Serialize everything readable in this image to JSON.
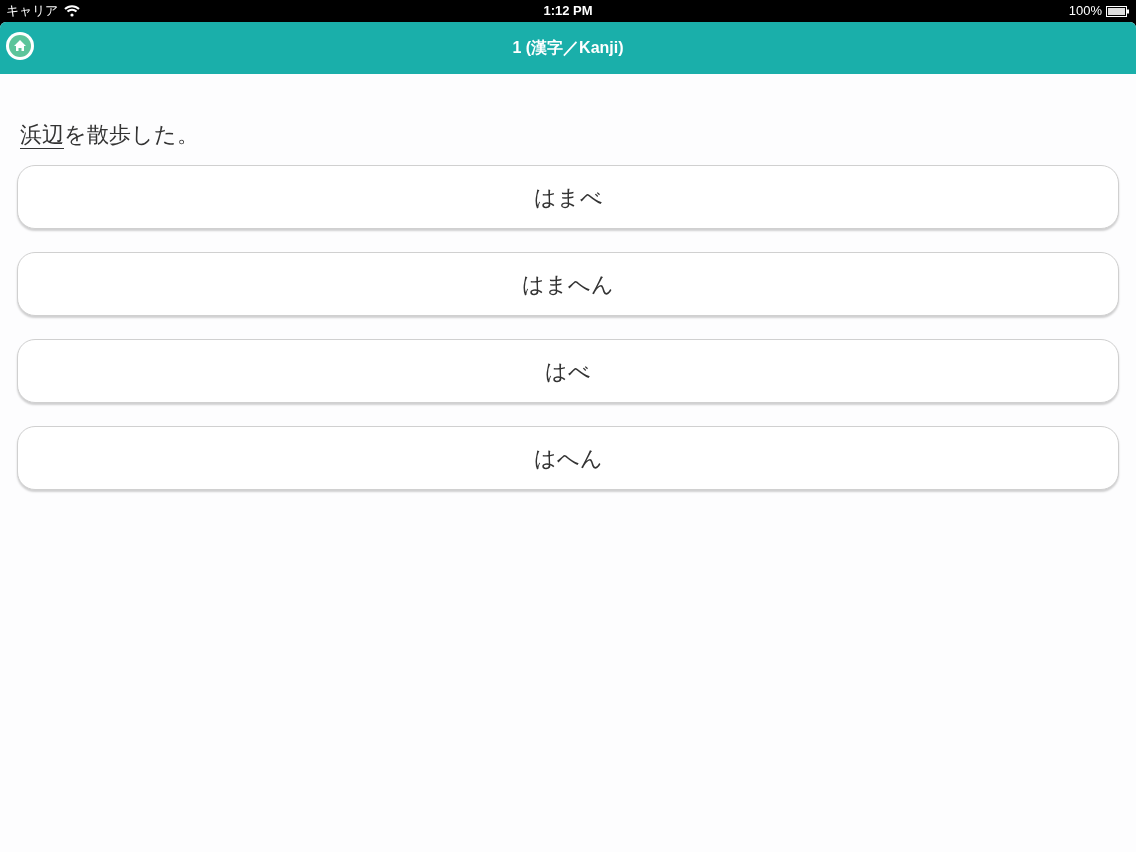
{
  "status_bar": {
    "carrier": "キャリア",
    "time": "1:12 PM",
    "battery": "100%"
  },
  "nav_bar": {
    "title": "1 (漢字／Kanji)"
  },
  "question": {
    "target": "浜辺",
    "rest": "を散歩した。"
  },
  "answers": [
    {
      "label": "はまべ"
    },
    {
      "label": "はまへん"
    },
    {
      "label": "はべ"
    },
    {
      "label": "はへん"
    }
  ]
}
